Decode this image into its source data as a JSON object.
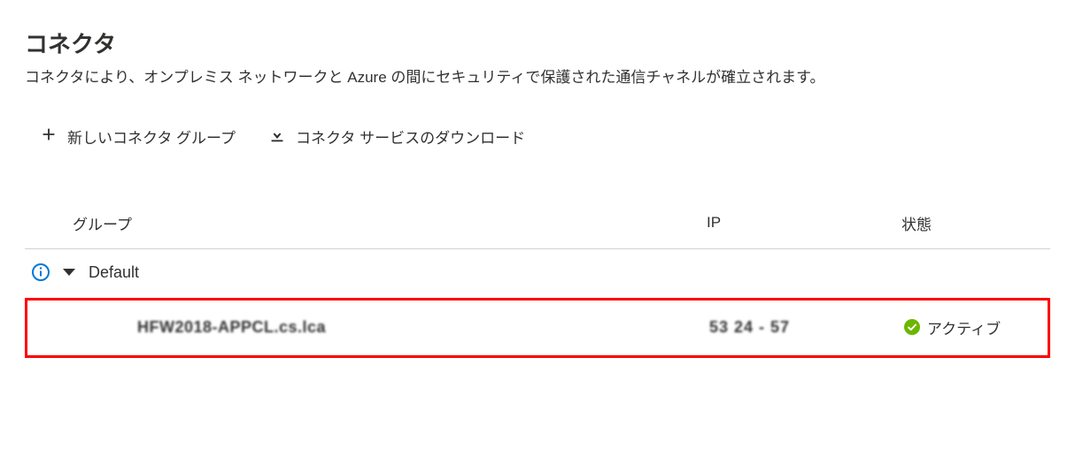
{
  "header": {
    "title": "コネクタ",
    "description": "コネクタにより、オンプレミス ネットワークと Azure の間にセキュリティで保護された通信チャネルが確立されます。"
  },
  "toolbar": {
    "new_group_label": "新しいコネクタ グループ",
    "download_label": "コネクタ サービスのダウンロード"
  },
  "table": {
    "columns": {
      "group": "グループ",
      "ip": "IP",
      "status": "状態"
    },
    "groups": [
      {
        "name": "Default",
        "connectors": [
          {
            "name": "HFW2018-APPCL.cs.lca",
            "ip": "53 24 - 57",
            "status": "アクティブ"
          }
        ]
      }
    ]
  },
  "colors": {
    "info": "#0078d4",
    "success": "#6bb700",
    "highlight_border": "#ff0000"
  }
}
